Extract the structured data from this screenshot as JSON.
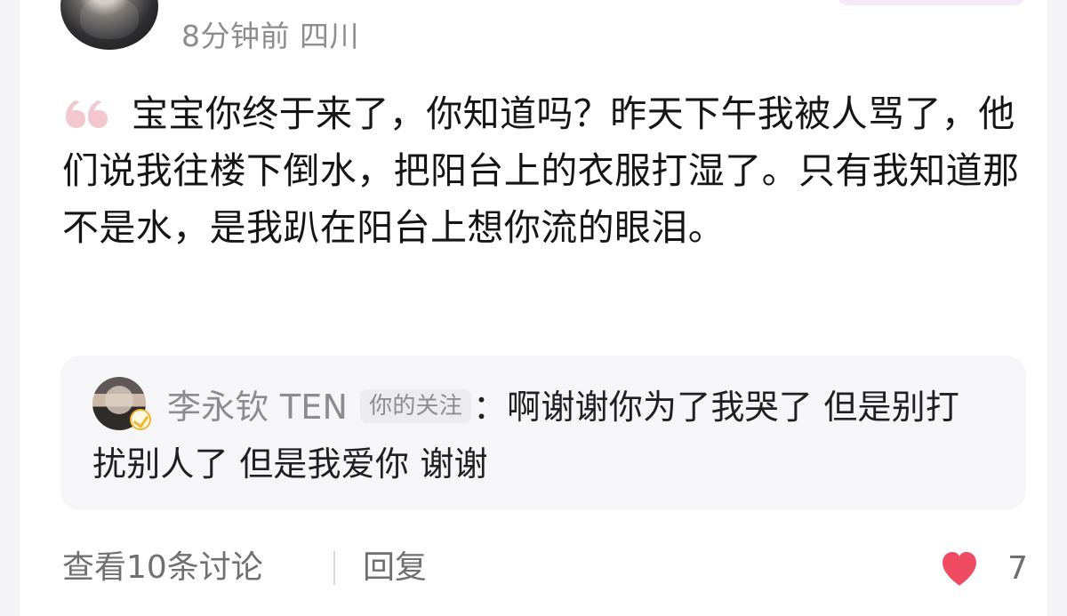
{
  "post": {
    "meta": "8分钟前 四川",
    "content": "宝宝你终于来了，你知道吗？昨天下午我被人骂了，他们说我往楼下倒水，把阳台上的衣服打湿了。只有我知道那不是水，是我趴在阳台上想你流的眼泪。"
  },
  "reply": {
    "user": "李永钦 TEN",
    "tag": "你的关注",
    "colon": "：",
    "text": "啊谢谢你为了我哭了 但是别打扰别人了 但是我爱你 谢谢"
  },
  "footer": {
    "view_discussions": "查看10条讨论",
    "reply_label": "回复",
    "like_count": "7"
  },
  "icons": {
    "quote": "quote-icon",
    "like": "heart-icon",
    "verified": "verified-badge-icon"
  },
  "colors": {
    "heart": "#ef4b63",
    "quote": "#f2c7d0",
    "reply_bg": "#f6f6f8",
    "meta_text": "#8d8d8d",
    "footer_text": "#707070"
  }
}
